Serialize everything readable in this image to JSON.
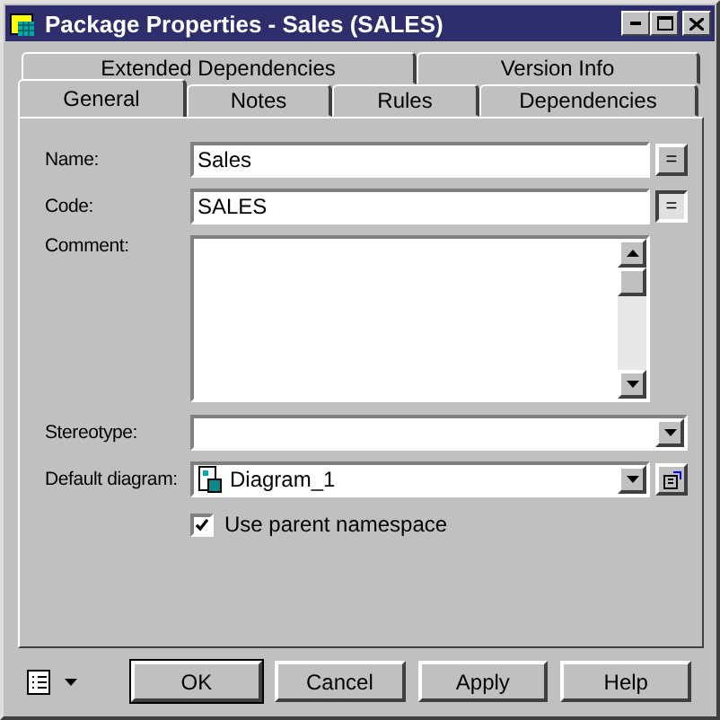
{
  "window": {
    "title": "Package Properties - Sales (SALES)"
  },
  "tabs": {
    "back_row": [
      {
        "label": "Extended Dependencies",
        "selected": false
      },
      {
        "label": "Version Info",
        "selected": false
      }
    ],
    "front_row": [
      {
        "label": "General",
        "selected": true
      },
      {
        "label": "Notes",
        "selected": false
      },
      {
        "label": "Rules",
        "selected": false
      },
      {
        "label": "Dependencies",
        "selected": false
      }
    ]
  },
  "form": {
    "fields": [
      {
        "kind": "text",
        "label": "Name:",
        "value": "Sales",
        "button": {
          "label": "=",
          "pressed": false
        }
      },
      {
        "kind": "text",
        "label": "Code:",
        "value": "SALES",
        "button": {
          "label": "=",
          "pressed": true
        }
      },
      {
        "kind": "memo",
        "label": "Comment:"
      },
      {
        "kind": "combo",
        "label": "Stereotype:"
      },
      {
        "kind": "diagram",
        "label": "Default diagram:",
        "value": "Diagram_1"
      }
    ],
    "checkbox": {
      "label": "Use parent namespace",
      "checked": true
    }
  },
  "buttons": [
    {
      "label": "OK",
      "default": true
    },
    {
      "label": "Cancel",
      "default": false
    },
    {
      "label": "Apply",
      "default": false
    },
    {
      "label": "Help",
      "default": false
    }
  ]
}
